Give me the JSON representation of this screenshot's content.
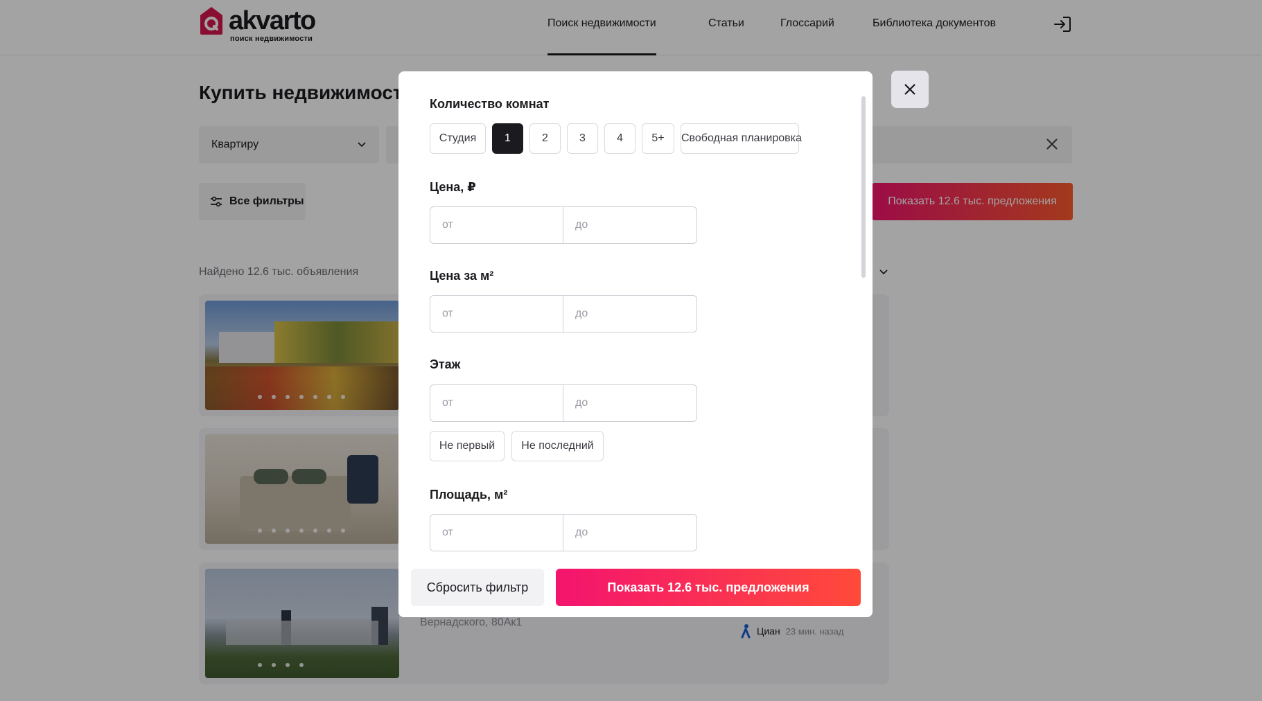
{
  "header": {
    "logo_word": "akvarto",
    "logo_sub": "поиск недвижимости",
    "nav": [
      {
        "label": "Поиск недвижимости",
        "active": true
      },
      {
        "label": "Статьи"
      },
      {
        "label": "Глоссарий"
      },
      {
        "label": "Библиотека документов"
      }
    ]
  },
  "page": {
    "title": "Купить недвижимость",
    "property_type": "Квартиру",
    "all_filters_label": "Все фильтры",
    "show_label": "Показать 12.6 тыс. предложения",
    "found_text": "Найдено 12.6 тыс. объявления",
    "listing": {
      "address": "Вернадского, 80Ак1",
      "source": "Циан",
      "time": "23 мин. назад"
    }
  },
  "modal": {
    "rooms": {
      "title": "Количество комнат",
      "options": [
        "Студия",
        "1",
        "2",
        "3",
        "4",
        "5+",
        "Свободная планировка"
      ],
      "selected": "1"
    },
    "price": {
      "title": "Цена, ₽",
      "from_placeholder": "от",
      "to_placeholder": "до"
    },
    "price_per_m2": {
      "title": "Цена за м²",
      "from_placeholder": "от",
      "to_placeholder": "до"
    },
    "floor": {
      "title": "Этаж",
      "from_placeholder": "от",
      "to_placeholder": "до",
      "options": [
        "Не первый",
        "Не последний"
      ]
    },
    "area": {
      "title": "Площадь, м²",
      "from_placeholder": "от",
      "to_placeholder": "до"
    },
    "footer": {
      "reset_label": "Сбросить фильтр",
      "show_label": "Показать 12.6 тыс. предложения"
    }
  },
  "colors": {
    "brand_gradient_start": "#f4146e",
    "brand_gradient_end": "#ff4a3a",
    "dark": "#1b1b1f"
  },
  "icons": [
    "logo-mark-icon",
    "chevron-down-icon",
    "close-icon",
    "filters-icon",
    "login-icon",
    "cian-source-icon"
  ]
}
